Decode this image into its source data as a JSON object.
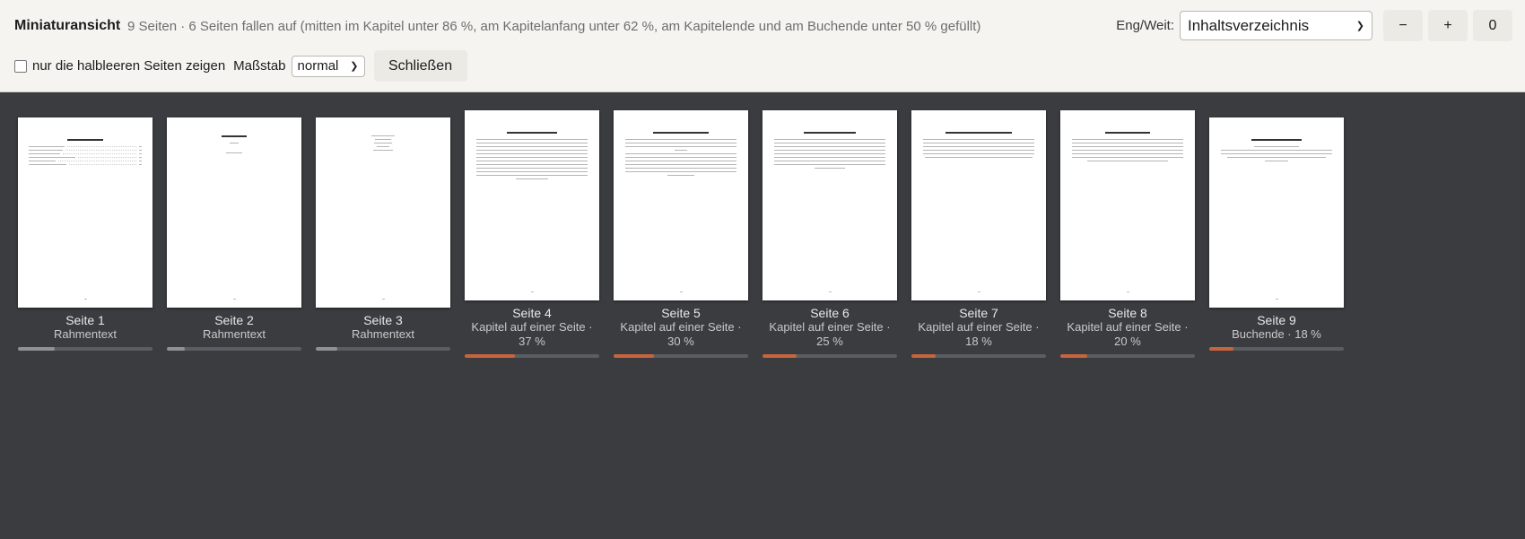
{
  "toolbar": {
    "title": "Miniaturansicht",
    "summary": "9 Seiten · 6 Seiten fallen auf (mitten im Kapitel unter 86 %, am Kapitelanfang unter 62 %, am Kapitelende und am Buchende unter 50 % gefüllt)",
    "eng_weit_label": "Eng/Weit:",
    "section_select_value": "Inhaltsverzeichnis",
    "minus_label": "−",
    "plus_label": "+",
    "zero_label": "0",
    "checkbox_label": "nur die halbleeren Seiten zeigen",
    "checkbox_checked": false,
    "scale_label": "Maßstab",
    "scale_value": "normal",
    "close_label": "Schließen"
  },
  "colors": {
    "bar_grey_fill": "#8e9196",
    "bar_warn_fill": "#c8643c"
  },
  "pages": [
    {
      "label": "Seite 1",
      "sub": "Rahmentext",
      "fill": 0.27,
      "warn": false
    },
    {
      "label": "Seite 2",
      "sub": "Rahmentext",
      "fill": 0.13,
      "warn": false
    },
    {
      "label": "Seite 3",
      "sub": "Rahmentext",
      "fill": 0.16,
      "warn": false
    },
    {
      "label": "Seite 4",
      "sub": "Kapitel auf einer Seite · 37 %",
      "fill": 0.37,
      "warn": true
    },
    {
      "label": "Seite 5",
      "sub": "Kapitel auf einer Seite · 30 %",
      "fill": 0.3,
      "warn": true
    },
    {
      "label": "Seite 6",
      "sub": "Kapitel auf einer Seite · 25 %",
      "fill": 0.25,
      "warn": true
    },
    {
      "label": "Seite 7",
      "sub": "Kapitel auf einer Seite · 18 %",
      "fill": 0.18,
      "warn": true
    },
    {
      "label": "Seite 8",
      "sub": "Kapitel auf einer Seite · 20 %",
      "fill": 0.2,
      "warn": true
    },
    {
      "label": "Seite 9",
      "sub": "Buchende · 18 %",
      "fill": 0.18,
      "warn": true
    }
  ]
}
